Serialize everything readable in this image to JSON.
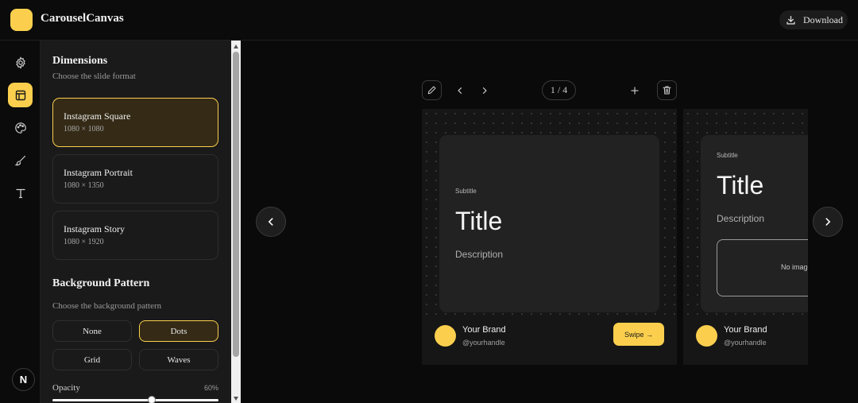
{
  "app": {
    "title": "CarouselCanvas",
    "download_label": "Download"
  },
  "rail": {
    "items": [
      "settings-icon",
      "layout-icon",
      "palette-icon",
      "brush-icon",
      "type-icon"
    ],
    "footer_badge": "N"
  },
  "panel": {
    "dimensions": {
      "title": "Dimensions",
      "subtitle": "Choose the slide format",
      "formats": [
        {
          "name": "Instagram Square",
          "size": "1080 × 1080"
        },
        {
          "name": "Instagram Portrait",
          "size": "1080 × 1350"
        },
        {
          "name": "Instagram Story",
          "size": "1080 × 1920"
        }
      ],
      "selected": "Instagram Square"
    },
    "background": {
      "title": "Background Pattern",
      "subtitle": "Choose the background pattern",
      "patterns": [
        "None",
        "Dots",
        "Grid",
        "Waves"
      ],
      "selected": "Dots",
      "opacity_label": "Opacity",
      "opacity_value": "60%",
      "opacity": 0.6
    }
  },
  "canvas": {
    "counter": "1 / 4",
    "slides": [
      {
        "subtitle": "Subtitle",
        "title": "Title",
        "description": "Description",
        "brand_name": "Your Brand",
        "brand_handle": "@yourhandle",
        "cta": "Swipe →"
      },
      {
        "subtitle": "Subtitle",
        "title": "Title",
        "description": "Description",
        "image_placeholder": "No image",
        "brand_name": "Your Brand",
        "brand_handle": "@yourhandle"
      }
    ]
  },
  "colors": {
    "accent": "#fbcf4d",
    "background": "#0a0a0a",
    "panel": "#1a1a1a"
  }
}
